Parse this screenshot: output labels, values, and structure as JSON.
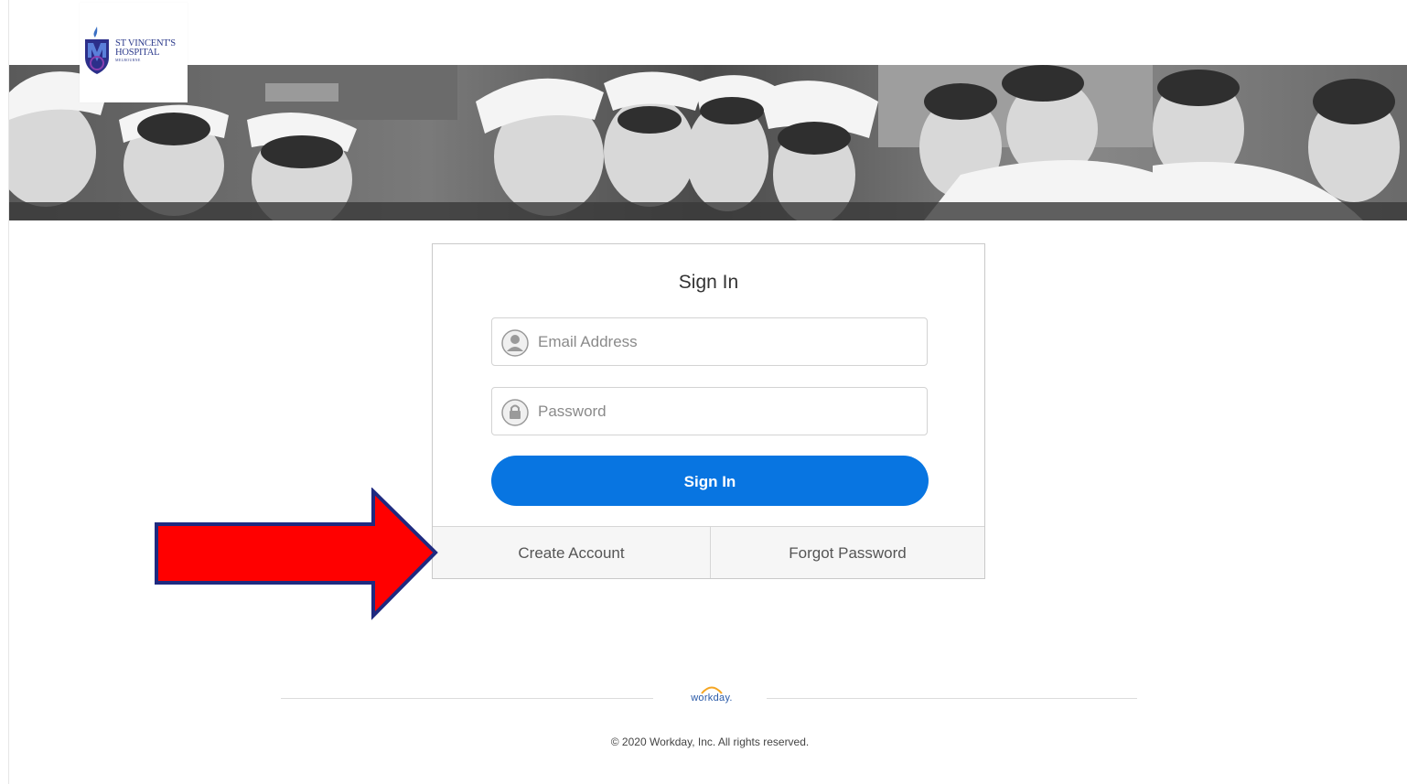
{
  "header": {
    "logo_line1": "ST VINCENT'S",
    "logo_line2": "HOSPITAL",
    "logo_line3": "MELBOURNE",
    "logo_icon": "st-vincents-crest-icon",
    "banner_image": "vintage nurses photograph"
  },
  "signin": {
    "title": "Sign In",
    "email_placeholder": "Email Address",
    "email_value": "",
    "email_icon": "user-icon",
    "password_placeholder": "Password",
    "password_value": "",
    "password_icon": "lock-icon",
    "button_label": "Sign In",
    "create_account": "Create Account",
    "forgot_password": "Forgot Password"
  },
  "footer": {
    "brand": "workday.",
    "copyright": "© 2020 Workday, Inc. All rights reserved."
  },
  "colors": {
    "primary_button": "#0875e1",
    "arrow_fill": "#ff0000",
    "arrow_border": "#1f2a80"
  },
  "annotation": {
    "type": "arrow",
    "points_to": "create-account-link"
  }
}
